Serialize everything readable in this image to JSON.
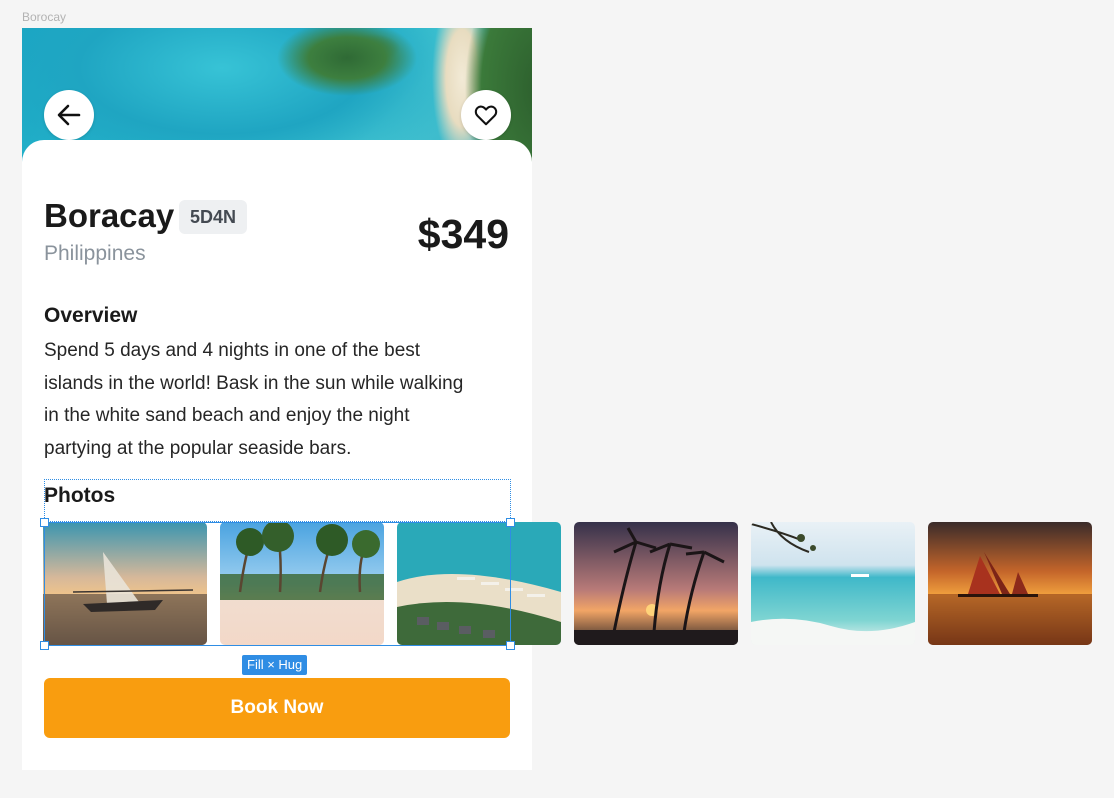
{
  "frame_label": "Borocay",
  "destination": {
    "name": "Boracay",
    "badge": "5D4N",
    "country": "Philippines",
    "price": "$349"
  },
  "overview": {
    "heading": "Overview",
    "lines": [
      "Spend 5 days and 4 nights in one of the best",
      "islands in the world! Bask in the sun while walking",
      "in the white sand beach and enjoy the night",
      "partying at the popular seaside bars."
    ]
  },
  "photos": {
    "heading": "Photos",
    "items": [
      "sunset-boat-photo",
      "palm-beach-photo",
      "aerial-resort-photo",
      "palm-sunset-photo",
      "turquoise-shore-photo",
      "sailboat-sunset-photo"
    ]
  },
  "selection_tag": "Fill × Hug",
  "cta": {
    "book_label": "Book Now"
  },
  "colors": {
    "accent": "#f99d0f",
    "selection": "#2f8de4"
  },
  "icons": [
    "arrow-left-icon",
    "heart-icon"
  ]
}
